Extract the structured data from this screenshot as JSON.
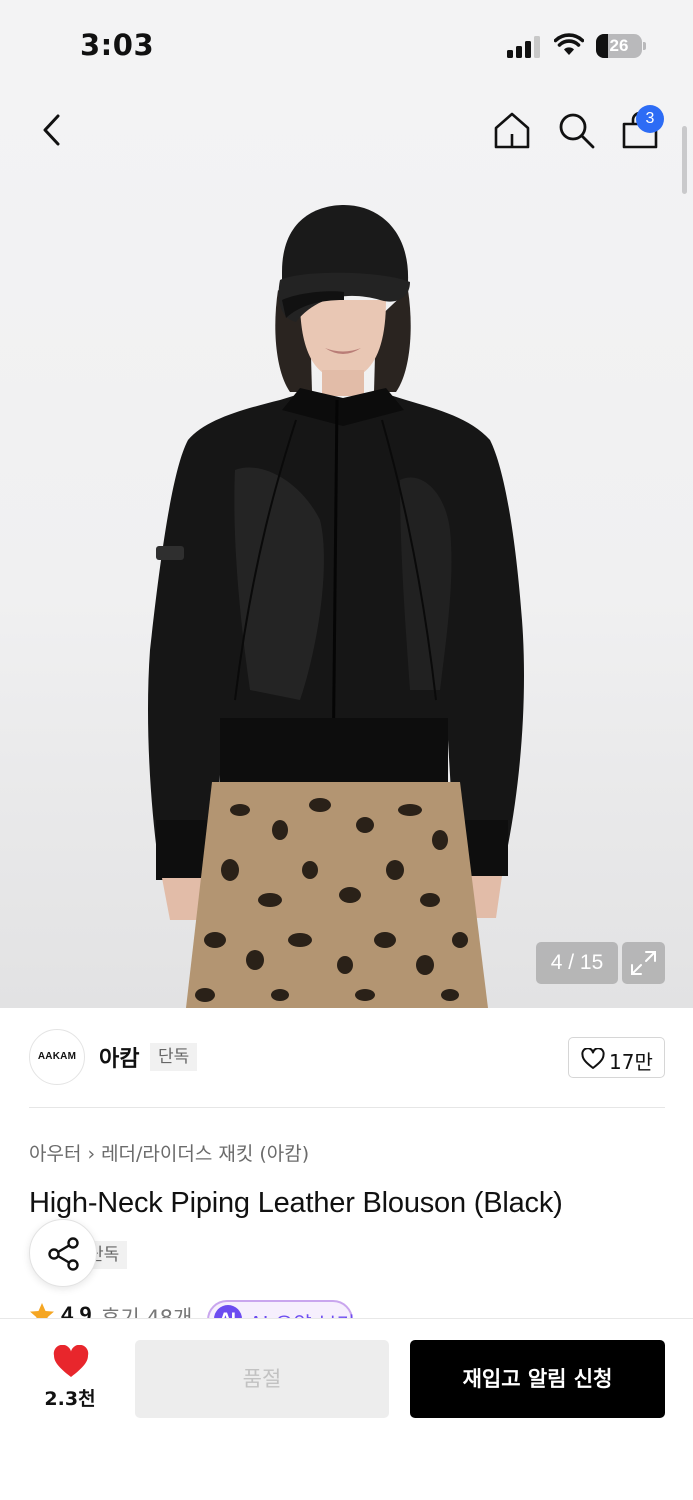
{
  "status_bar": {
    "time": "3:03",
    "battery": "26"
  },
  "nav": {
    "back_icon": "chevron-left-icon",
    "home_icon": "home-icon",
    "search_icon": "search-icon",
    "cart_icon": "shopping-bag-icon",
    "cart_badge": "3"
  },
  "gallery": {
    "counter": "4 / 15",
    "expand_icon": "expand-icon",
    "logo_text": "AAKAM"
  },
  "brand": {
    "logo_text": "AAKAM",
    "name": "아캄",
    "tag": "단독",
    "likes": "17만"
  },
  "product": {
    "category": "아우터",
    "subcategory": "레더/라이더스 재킷 (아캄)",
    "title": "High-Neck Piping Leather Blouson (Black)",
    "tag": "단독",
    "rating": "4.9",
    "reviews": "후기 48개",
    "ai_badge": "AI",
    "ai_summary": "AI 요약 보기"
  },
  "bottom_bar": {
    "like_count": "2.3천",
    "soldout_label": "품절",
    "restock_label": "재입고 알림 신청"
  },
  "colors": {
    "accent_blue": "#2d6cf5",
    "heart_red": "#e8262c",
    "ai_purple": "#6c4cf0",
    "primary_button": "#000000"
  }
}
